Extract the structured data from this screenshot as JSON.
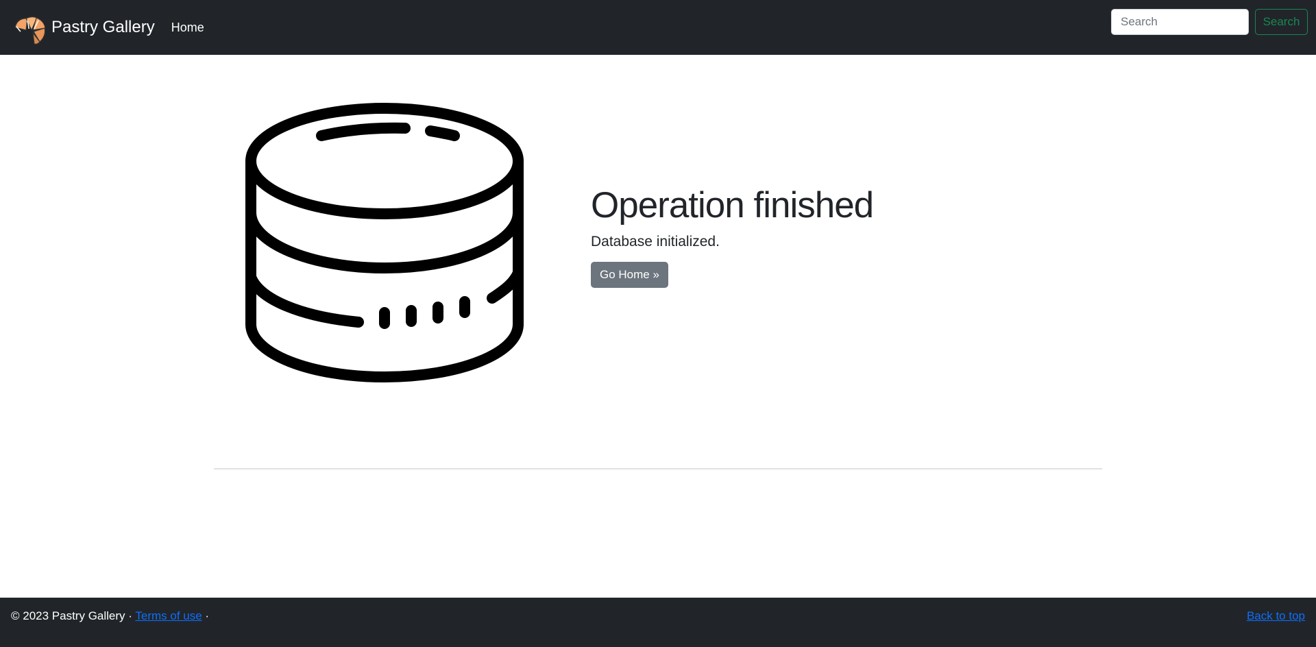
{
  "navbar": {
    "brand_name": "Pastry Gallery",
    "logo_icon": "croissant-icon",
    "home_label": "Home",
    "search": {
      "placeholder": "Search",
      "value": "",
      "button_label": "Search"
    }
  },
  "main": {
    "illustration_icon": "database-icon",
    "title": "Operation finished",
    "message": "Database initialized.",
    "go_home_label": "Go Home »"
  },
  "footer": {
    "copyright": "© 2023 Pastry Gallery ·",
    "terms_label": "Terms of use",
    "trailing_separator": "·",
    "back_to_top_label": "Back to top"
  },
  "colors": {
    "navbar_bg": "#212529",
    "search_button_outline": "#198754",
    "go_home_button_bg": "#6c757d",
    "link": "#0d6efd"
  }
}
